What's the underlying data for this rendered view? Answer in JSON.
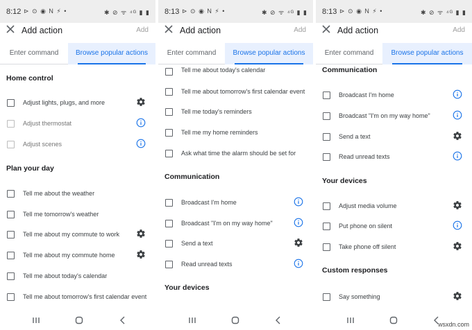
{
  "watermark": "wsxdn.com",
  "panels": [
    {
      "status": {
        "time": "8:12",
        "left_icons": "⊳ ⊙ ◉ N ⚡ •",
        "right_icons": "✱ ⊘ ᯤ ⁴ᴳ ▮ ▮"
      },
      "header": {
        "title": "Add action",
        "add_label": "Add"
      },
      "tabs": {
        "enter_command": "Enter command",
        "browse": "Browse popular actions"
      },
      "sections": [
        {
          "title": "Home control"
        },
        {
          "title": "Plan your day"
        }
      ],
      "items": [
        {
          "label": "Adjust lights, plugs, and more",
          "icon": "gear-icon"
        },
        {
          "label": "Adjust thermostat",
          "icon": "info-icon",
          "disabled": true
        },
        {
          "label": "Adjust scenes",
          "icon": "info-icon",
          "disabled": true
        },
        {
          "label": "Tell me about the weather"
        },
        {
          "label": "Tell me tomorrow's weather"
        },
        {
          "label": "Tell me about my commute to work",
          "icon": "gear-icon"
        },
        {
          "label": "Tell me about my commute home",
          "icon": "gear-icon"
        },
        {
          "label": "Tell me about today's calendar"
        },
        {
          "label": "Tell me about tomorrow's first calendar event"
        }
      ]
    },
    {
      "status": {
        "time": "8:13",
        "left_icons": "⊳ ⊙ ◉ N ⚡ •",
        "right_icons": "✱ ⊘ ᯤ ⁴ᴳ ▮ ▮"
      },
      "header": {
        "title": "Add action",
        "add_label": "Add"
      },
      "tabs": {
        "enter_command": "Enter command",
        "browse": "Browse popular actions"
      },
      "sections": [
        {
          "title": "Communication"
        },
        {
          "title": "Your devices"
        }
      ],
      "items": [
        {
          "label": "Tell me about today's calendar"
        },
        {
          "label": "Tell me about tomorrow's first calendar event"
        },
        {
          "label": "Tell me today's reminders"
        },
        {
          "label": "Tell me my home reminders"
        },
        {
          "label": "Ask what time the alarm should be set for"
        },
        {
          "label": "Broadcast I'm home",
          "icon": "info-icon"
        },
        {
          "label": "Broadcast \"I'm on my way home\"",
          "icon": "info-icon"
        },
        {
          "label": "Send a text",
          "icon": "gear-icon"
        },
        {
          "label": "Read unread texts",
          "icon": "info-icon"
        }
      ]
    },
    {
      "status": {
        "time": "8:13",
        "left_icons": "⊳ ⊙ ◉ N ⚡ •",
        "right_icons": "✱ ⊘ ᯤ ⁴ᴳ ▮ ▮"
      },
      "header": {
        "title": "Add action",
        "add_label": "Add"
      },
      "tabs": {
        "enter_command": "Enter command",
        "browse": "Browse popular actions"
      },
      "sections": [
        {
          "title": "Communication"
        },
        {
          "title": "Your devices"
        },
        {
          "title": "Custom responses"
        }
      ],
      "items": [
        {
          "label": "Broadcast I'm home",
          "icon": "info-icon"
        },
        {
          "label": "Broadcast \"I'm on my way home\"",
          "icon": "info-icon"
        },
        {
          "label": "Send a text",
          "icon": "gear-icon"
        },
        {
          "label": "Read unread texts",
          "icon": "info-icon"
        },
        {
          "label": "Adjust media volume",
          "icon": "gear-icon"
        },
        {
          "label": "Put phone on silent",
          "icon": "info-icon"
        },
        {
          "label": "Take phone off silent",
          "icon": "gear-icon"
        },
        {
          "label": "Say something",
          "icon": "gear-icon"
        }
      ]
    }
  ]
}
